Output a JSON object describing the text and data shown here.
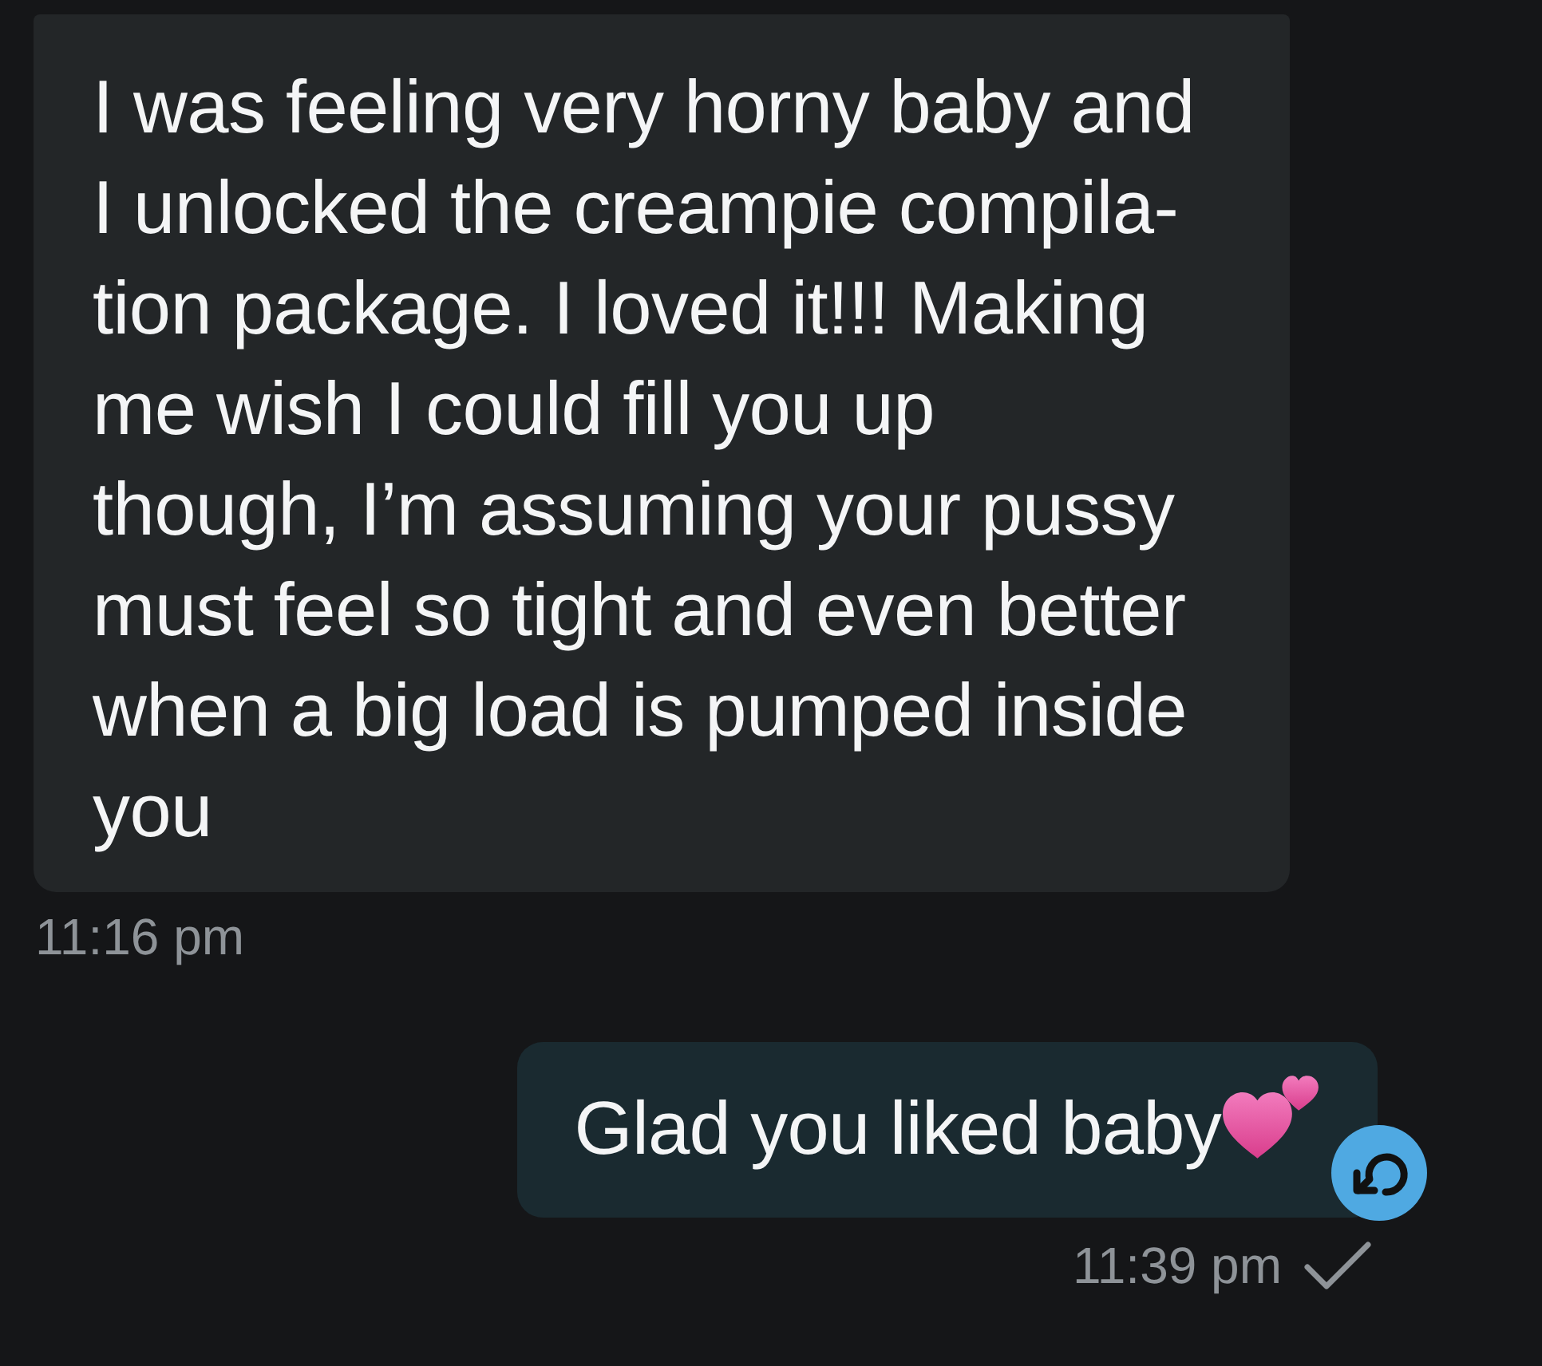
{
  "messages": [
    {
      "kind": "incoming",
      "text": "I was feeling very horny baby and\nI unlocked the creampie compila-\ntion package. I loved it!!! Making\nme wish I could fill you up\nthough, I’m assuming your pussy\nmust feel so tight and even better\nwhen a big load is pumped inside\nyou",
      "time": "11:16 pm"
    },
    {
      "kind": "outgoing",
      "text": "Glad you liked baby",
      "time": "11:39 pm"
    }
  ]
}
